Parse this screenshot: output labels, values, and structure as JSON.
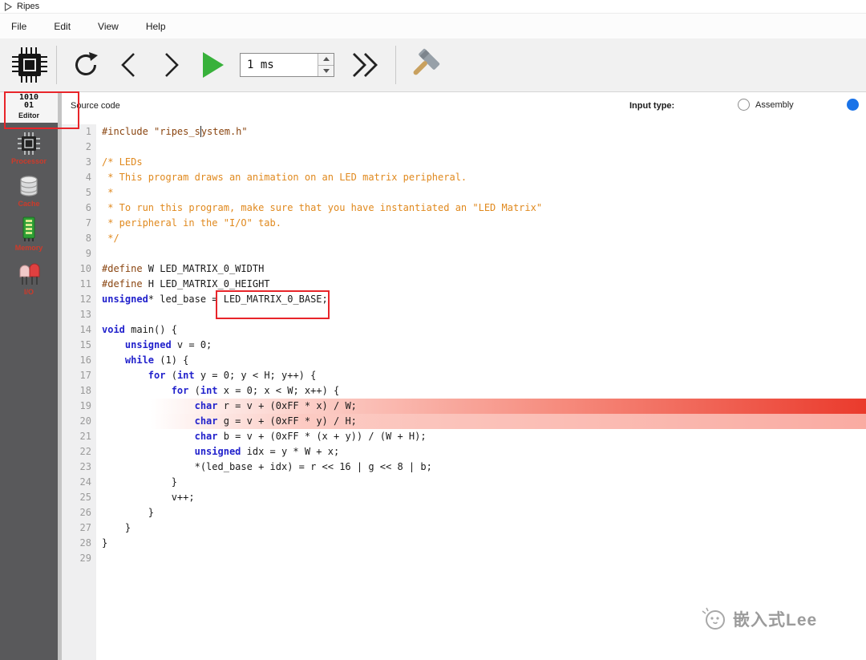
{
  "window": {
    "title": "Ripes"
  },
  "menu": {
    "items": [
      {
        "label": "File"
      },
      {
        "label": "Edit"
      },
      {
        "label": "View"
      },
      {
        "label": "Help"
      }
    ]
  },
  "toolbar": {
    "speed_value": "1 ms",
    "icons": [
      "chip-icon",
      "reset-icon",
      "step-back-icon",
      "step-forward-icon",
      "run-icon",
      "fast-forward-icon",
      "build-hammer-icon"
    ]
  },
  "sidebar": {
    "items": [
      {
        "label": "Editor",
        "selected": true,
        "icon": "binary-editor-icon",
        "icon_lines": [
          "1010",
          "01"
        ]
      },
      {
        "label": "Processor",
        "selected": false,
        "icon": "processor-chip-icon"
      },
      {
        "label": "Cache",
        "selected": false,
        "icon": "cache-cylinder-icon"
      },
      {
        "label": "Memory",
        "selected": false,
        "icon": "memory-ram-icon"
      },
      {
        "label": "I/O",
        "selected": false,
        "icon": "io-leds-icon"
      }
    ]
  },
  "editor": {
    "source_label": "Source code",
    "input_type_label": "Input type:",
    "options": [
      {
        "label": "Assembly",
        "selected": false
      },
      {
        "label": "",
        "selected": true
      }
    ]
  },
  "code": {
    "lines": [
      {
        "n": 1,
        "segs": [
          {
            "c": "d",
            "t": "#include \"ripes_s"
          },
          {
            "c": "caret",
            "t": ""
          },
          {
            "c": "d",
            "t": "ystem.h\""
          }
        ]
      },
      {
        "n": 2,
        "segs": []
      },
      {
        "n": 3,
        "segs": [
          {
            "c": "c",
            "t": "/* LEDs"
          }
        ]
      },
      {
        "n": 4,
        "segs": [
          {
            "c": "c",
            "t": " * This program draws an animation on an LED matrix peripheral."
          }
        ]
      },
      {
        "n": 5,
        "segs": [
          {
            "c": "c",
            "t": " *"
          }
        ]
      },
      {
        "n": 6,
        "segs": [
          {
            "c": "c",
            "t": " * To run this program, make sure that you have instantiated an \"LED Matrix\""
          }
        ]
      },
      {
        "n": 7,
        "segs": [
          {
            "c": "c",
            "t": " * peripheral in the \"I/O\" tab."
          }
        ]
      },
      {
        "n": 8,
        "segs": [
          {
            "c": "c",
            "t": " */"
          }
        ]
      },
      {
        "n": 9,
        "segs": []
      },
      {
        "n": 10,
        "segs": [
          {
            "c": "d",
            "t": "#define"
          },
          {
            "c": "p",
            "t": " W LED_MATRIX_0_WIDTH"
          }
        ]
      },
      {
        "n": 11,
        "segs": [
          {
            "c": "d",
            "t": "#define"
          },
          {
            "c": "p",
            "t": " H LED_MATRIX_0_HEIGHT"
          }
        ]
      },
      {
        "n": 12,
        "segs": [
          {
            "c": "k",
            "t": "unsigned"
          },
          {
            "c": "p",
            "t": "* led_base = LED_MATRIX_0_BASE;"
          }
        ]
      },
      {
        "n": 13,
        "segs": []
      },
      {
        "n": 14,
        "segs": [
          {
            "c": "k",
            "t": "void"
          },
          {
            "c": "p",
            "t": " main() {"
          }
        ]
      },
      {
        "n": 15,
        "segs": [
          {
            "c": "p",
            "t": "    "
          },
          {
            "c": "k",
            "t": "unsigned"
          },
          {
            "c": "p",
            "t": " v = 0;"
          }
        ]
      },
      {
        "n": 16,
        "segs": [
          {
            "c": "p",
            "t": "    "
          },
          {
            "c": "k",
            "t": "while"
          },
          {
            "c": "p",
            "t": " (1) {"
          }
        ]
      },
      {
        "n": 17,
        "segs": [
          {
            "c": "p",
            "t": "        "
          },
          {
            "c": "k",
            "t": "for"
          },
          {
            "c": "p",
            "t": " ("
          },
          {
            "c": "k",
            "t": "int"
          },
          {
            "c": "p",
            "t": " y = 0; y < H; y++) {"
          }
        ]
      },
      {
        "n": 18,
        "segs": [
          {
            "c": "p",
            "t": "            "
          },
          {
            "c": "k",
            "t": "for"
          },
          {
            "c": "p",
            "t": " ("
          },
          {
            "c": "k",
            "t": "int"
          },
          {
            "c": "p",
            "t": " x = 0; x < W; x++) {"
          }
        ]
      },
      {
        "n": 19,
        "hl": "strong",
        "segs": [
          {
            "c": "p",
            "t": "                "
          },
          {
            "c": "k",
            "t": "char"
          },
          {
            "c": "p",
            "t": " r = v + (0xFF * x) / W;"
          }
        ]
      },
      {
        "n": 20,
        "hl": "soft",
        "segs": [
          {
            "c": "p",
            "t": "                "
          },
          {
            "c": "k",
            "t": "char"
          },
          {
            "c": "p",
            "t": " g = v + (0xFF * y) / H;"
          }
        ]
      },
      {
        "n": 21,
        "segs": [
          {
            "c": "p",
            "t": "                "
          },
          {
            "c": "k",
            "t": "char"
          },
          {
            "c": "p",
            "t": " b = v + (0xFF * (x + y)) / (W + H);"
          }
        ]
      },
      {
        "n": 22,
        "segs": [
          {
            "c": "p",
            "t": "                "
          },
          {
            "c": "k",
            "t": "unsigned"
          },
          {
            "c": "p",
            "t": " idx = y * W + x;"
          }
        ]
      },
      {
        "n": 23,
        "segs": [
          {
            "c": "p",
            "t": "                *(led_base + idx) = r << 16 | g << 8 | b;"
          }
        ]
      },
      {
        "n": 24,
        "segs": [
          {
            "c": "p",
            "t": "            }"
          }
        ]
      },
      {
        "n": 25,
        "segs": [
          {
            "c": "p",
            "t": "            v++;"
          }
        ]
      },
      {
        "n": 26,
        "segs": [
          {
            "c": "p",
            "t": "        }"
          }
        ]
      },
      {
        "n": 27,
        "segs": [
          {
            "c": "p",
            "t": "    }"
          }
        ]
      },
      {
        "n": 28,
        "segs": [
          {
            "c": "p",
            "t": "}"
          }
        ]
      },
      {
        "n": 29,
        "segs": []
      }
    ]
  },
  "watermark": {
    "text": "嵌入式Lee"
  },
  "colors": {
    "accent_blue": "#1a73e8",
    "annotation_red": "#e8252a",
    "highlight_red": "#e93021",
    "sidebar_bg": "#59595b",
    "comment_orange": "#e0891e",
    "keyword_blue": "#2222cc",
    "directive_brown": "#8a4510"
  }
}
